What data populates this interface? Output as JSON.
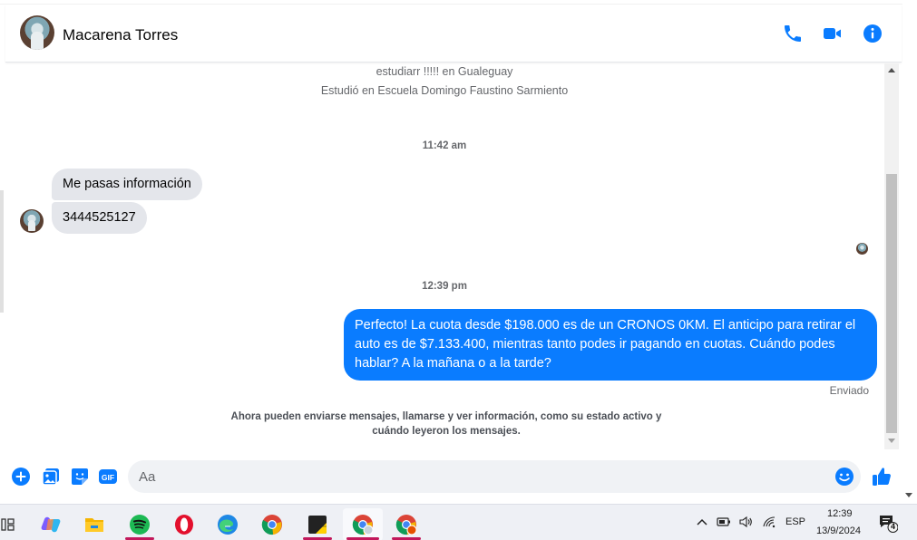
{
  "colors": {
    "accent": "#0a7cff",
    "incoming_bubble": "#e4e6eb",
    "outgoing_bubble": "#0a7cff",
    "muted_text": "#65676b"
  },
  "header": {
    "contact_name": "Macarena Torres",
    "icons": [
      "phone-icon",
      "video-camera-icon",
      "info-icon"
    ]
  },
  "profile_info": {
    "line1": "estudiarr !!!!! en Gualeguay",
    "line2": "Estudió en Escuela Domingo Faustino Sarmiento"
  },
  "messages": {
    "time_1": "11:42 am",
    "incoming": [
      "Me pasas información",
      "3444525127"
    ],
    "time_2": "12:39 pm",
    "outgoing": "Perfecto! La cuota desde $198.000 es de un CRONOS 0KM. El anticipo para retirar el auto es de $7.133.400, mientras tanto podes ir pagando en cuotas. Cuándo podes hablar? A la mañana o a la tarde?",
    "status": "Enviado",
    "notice": "Ahora pueden enviarse mensajes, llamarse y ver información, como su estado activo y cuándo leyeron los mensajes."
  },
  "composer": {
    "placeholder": "Aa",
    "gif_label": "GIF",
    "icons": [
      "plus-icon",
      "image-icon",
      "sticker-icon",
      "gif-icon",
      "emoji-icon",
      "thumbs-up-icon"
    ]
  },
  "taskbar": {
    "apps": [
      "task-view-icon",
      "copilot-icon",
      "file-explorer-icon",
      "spotify-icon",
      "opera-icon",
      "edge-icon",
      "chrome-icon",
      "sticky-notes-icon",
      "chrome-profile-icon",
      "chrome-profile-2-icon"
    ],
    "tray": {
      "language": "ESP",
      "time": "12:39",
      "date": "13/9/2024",
      "notification_count": "4"
    }
  }
}
